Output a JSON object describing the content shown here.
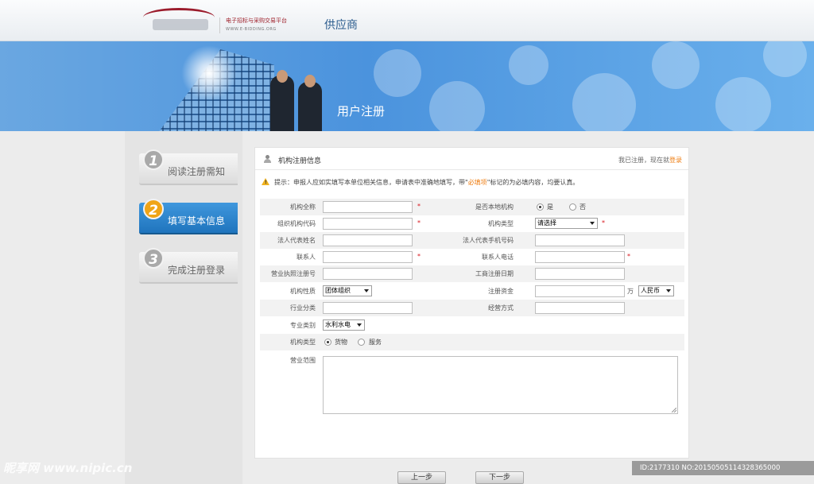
{
  "header": {
    "logo_cn": "电子招标与采购交易平台",
    "logo_url": "WWW.E-BIDDING.ORG",
    "site_title": "供应商"
  },
  "banner": {
    "title": "用户注册"
  },
  "steps": [
    {
      "num": "1",
      "label": "阅读注册需知",
      "active": false
    },
    {
      "num": "2",
      "label": "填写基本信息",
      "active": true
    },
    {
      "num": "3",
      "label": "完成注册登录",
      "active": false
    }
  ],
  "panel": {
    "title": "机构注册信息",
    "already_registered": "我已注册，现在就",
    "login_link": "登录",
    "tip_prefix": "提示：申报人应如实填写本单位相关信息，申请表中准确地填写，带\"",
    "tip_required": "必填项",
    "tip_suffix": "\"标记的为必填内容，均要认真。"
  },
  "form": {
    "org_full_name": "机构全称",
    "is_local": "是否本地机构",
    "yes": "是",
    "no": "否",
    "org_code": "组织机构代码",
    "org_type": "机构类型",
    "org_type_value": "请选择",
    "legal_rep_name": "法人代表姓名",
    "legal_rep_phone": "法人代表手机号码",
    "contact": "联系人",
    "contact_phone": "联系人电话",
    "license_no": "营业执照注册号",
    "reg_date": "工商注册日期",
    "org_nature": "机构性质",
    "org_nature_value": "团体组织",
    "reg_capital": "注册资金",
    "capital_unit": "万",
    "currency_value": "人民币",
    "industry": "行业分类",
    "biz_mode": "经营方式",
    "specialty": "专业类别",
    "specialty_value": "水利水电",
    "org_category": "机构类型",
    "goods": "货物",
    "service": "服务",
    "biz_scope": "营业范围",
    "required_mark": "*"
  },
  "buttons": {
    "prev": "上一步",
    "next": "下一步"
  },
  "watermark": {
    "left": "昵享网 www.nipic.cn",
    "right": "ID:2177310 NO:20150505114328365000"
  }
}
